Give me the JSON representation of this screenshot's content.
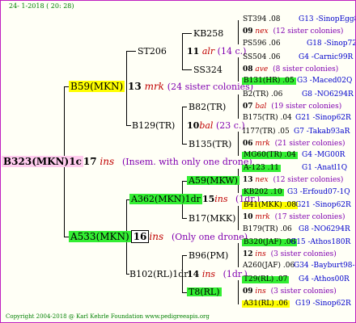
{
  "header": {
    "date": "24- 1-2018 ( 20: 28)",
    "copyright": "Copyright 2004-2018 @ Karl Kehrle Foundation   www.pedigreeapis.org"
  },
  "colors": {
    "yellow": "#ffff00",
    "green": "#33ee33",
    "pink": "#ffccee",
    "red": "#c00000",
    "blue": "#0000cc",
    "purple": "#8000b0"
  },
  "root": {
    "name": "B323(MKN)1c",
    "num": "17",
    "code": "ins",
    "note": "(Insem. with only one drone)"
  },
  "g1_top": {
    "name": "B59(MKN)",
    "num": "13",
    "code": "mrk",
    "note": "(24 sister colonies)"
  },
  "g1_bot": {
    "name": "A533(MKN)",
    "num": "16",
    "code": "ins",
    "note": "(Only one drone)"
  },
  "g2": {
    "st206": {
      "name": "ST206",
      "num": "11",
      "code": "alr",
      "note": "(14 c.)"
    },
    "b129": {
      "name": "B129(TR)",
      "num": "10",
      "code": "bal",
      "note": "(23 c.)"
    },
    "a362": {
      "name": "A362(MKN)1dr",
      "num": "15",
      "code": "ins",
      "note": "(1dr.)"
    },
    "b102": {
      "name": "B102(RL)1dr",
      "num": "14",
      "code": "ins",
      "note": "(1dr.)"
    }
  },
  "g3": {
    "kb258": "KB258",
    "ss324": "SS324",
    "b82": "B82(TR)",
    "b135": "B135(TR)",
    "a59": "A59(MKW)",
    "b17": "B17(MKK)",
    "b96": "B96(PM)",
    "t8": "T8(RL)"
  },
  "g4": [
    {
      "l": "ST394 .08",
      "r": "G13 -SinopEgg86R"
    },
    {
      "n": "09",
      "c": "nex",
      "s": "(12 sister colonies)"
    },
    {
      "l": "PS596 .06",
      "r": "G18 -Sinop72R"
    },
    {
      "l": "SS504 .06",
      "r": "G4 -Carnic99R"
    },
    {
      "n": "08",
      "c": "ave",
      "s": "(8 sister colonies)"
    },
    {
      "l": "B131(HR) .05",
      "r": "G3 -Maced02Q"
    },
    {
      "l": "B2(TR) .06",
      "r": "G8 -NO6294R"
    },
    {
      "n": "07",
      "c": "bal",
      "s": "(19 sister colonies)"
    },
    {
      "l": "B175(TR) .04",
      "r": "G21 -Sinop62R"
    },
    {
      "l": "I177(TR) .05",
      "r": "G7 -Takab93aR"
    },
    {
      "n": "06",
      "c": "mrk",
      "s": "(21 sister colonies)"
    },
    {
      "l": "MG60(TR) .04",
      "r": "G4 -MG00R"
    },
    {
      "l": "A-123 .11",
      "r": "G1 -Anatl1Q"
    },
    {
      "n": "13",
      "c": "nex",
      "s": "(12 sister colonies)"
    },
    {
      "l": "KB202 .10",
      "r": "G3 -Erfoud07-1Q"
    },
    {
      "l": "B41(MKK) .08",
      "r": "G21 -Sinop62R"
    },
    {
      "n": "10",
      "c": "mrk",
      "s": "(17 sister colonies)"
    },
    {
      "l": "B179(TR) .06",
      "r": "G8 -NO6294R"
    },
    {
      "l": "B320(JAF) .08",
      "r": "G15 -Athos180R"
    },
    {
      "n": "12",
      "c": "ins",
      "s": "(3 sister colonies)"
    },
    {
      "l": "A260(JAF) .06",
      "r": "G34 -Bayburt98-3"
    },
    {
      "l": "T29(RL) .07",
      "r": "G4 -Athos00R"
    },
    {
      "n": "09",
      "c": "ins",
      "s": "(3 sister colonies)"
    },
    {
      "l": "A31(RL) .06",
      "r": "G19 -Sinop62R"
    }
  ]
}
